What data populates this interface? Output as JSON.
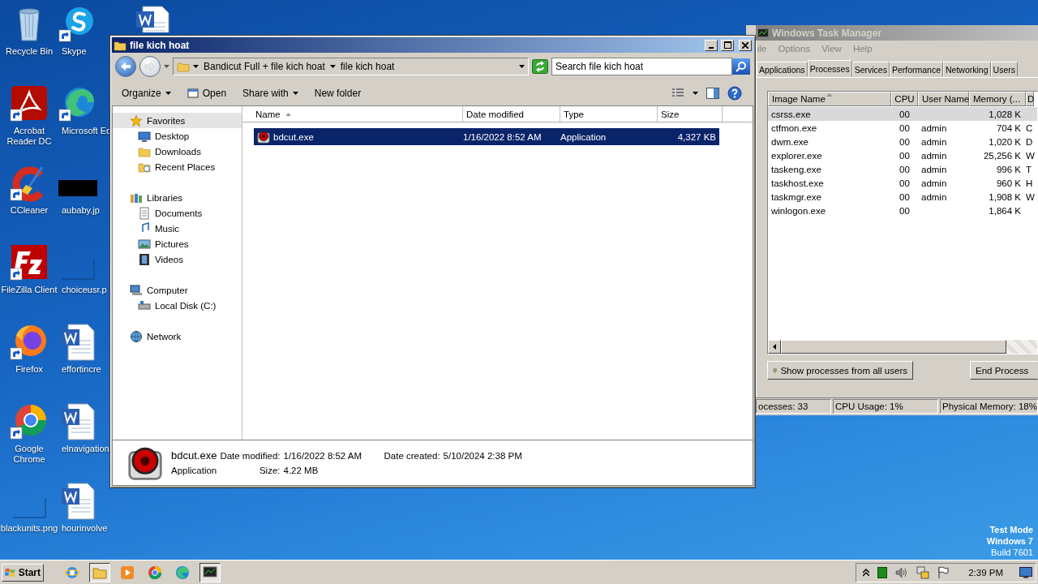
{
  "desktop": {
    "icons": [
      {
        "label": "Recycle Bin",
        "kind": "recycle",
        "shortcut": false
      },
      {
        "label": "Acrobat Reader DC",
        "kind": "acrobat",
        "shortcut": true
      },
      {
        "label": "CCleaner",
        "kind": "ccleaner",
        "shortcut": true
      },
      {
        "label": "FileZilla Client",
        "kind": "filezilla",
        "shortcut": true
      },
      {
        "label": "Firefox",
        "kind": "firefox",
        "shortcut": true
      },
      {
        "label": "Google Chrome",
        "kind": "chrome",
        "shortcut": true
      },
      {
        "label": "blackunits.png",
        "kind": "blank",
        "shortcut": false
      },
      {
        "label": "Skype",
        "kind": "skype",
        "shortcut": true
      },
      {
        "label": "Microsoft Ed",
        "kind": "edge",
        "shortcut": true
      },
      {
        "label": "aubaby.jp",
        "kind": "dark-image",
        "shortcut": false
      },
      {
        "label": "choiceusr.p",
        "kind": "blank",
        "shortcut": false
      },
      {
        "label": "effortincre",
        "kind": "word",
        "shortcut": false
      },
      {
        "label": "elnavigation",
        "kind": "word",
        "shortcut": false
      },
      {
        "label": "hourinvolve",
        "kind": "word",
        "shortcut": false
      },
      {
        "kind": "word",
        "shortcut": false
      }
    ],
    "notice": [
      "Test Mode",
      "Windows 7",
      "Build 7601"
    ]
  },
  "explorer": {
    "title": "file kich hoat",
    "active": true,
    "breadcrumb": [
      "Bandicut Full + file kich hoat",
      "file kich hoat"
    ],
    "search": {
      "placeholder": "Search file kich hoat"
    },
    "toolbar": [
      {
        "label": "Organize",
        "kind": "menu"
      },
      {
        "label": "Open",
        "kind": "open"
      },
      {
        "label": "Share with",
        "kind": "menu"
      },
      {
        "label": "New folder",
        "kind": "plain"
      }
    ],
    "nav": [
      {
        "label": "Favorites",
        "kind": "star",
        "selected": true,
        "children": [
          {
            "label": "Desktop",
            "kind": "desktop",
            "selected": false
          },
          {
            "label": "Downloads",
            "kind": "folder",
            "selected": false
          },
          {
            "label": "Recent Places",
            "kind": "recent",
            "selected": false
          }
        ]
      },
      {
        "label": "Libraries",
        "kind": "library",
        "selected": false,
        "children": [
          {
            "label": "Documents",
            "kind": "documents",
            "selected": false
          },
          {
            "label": "Music",
            "kind": "music",
            "selected": false
          },
          {
            "label": "Pictures",
            "kind": "pictures",
            "selected": false
          },
          {
            "label": "Videos",
            "kind": "videos",
            "selected": false
          }
        ]
      },
      {
        "label": "Computer",
        "kind": "computer",
        "selected": false,
        "children": [
          {
            "label": "Local Disk (C:)",
            "kind": "disk",
            "selected": false
          }
        ]
      },
      {
        "label": "Network",
        "kind": "network",
        "selected": false
      }
    ],
    "columns": [
      {
        "label": "Name",
        "sorted": true
      },
      {
        "label": "Date modified",
        "sorted": false
      },
      {
        "label": "Type",
        "sorted": false
      },
      {
        "label": "Size",
        "sorted": false
      }
    ],
    "files": [
      {
        "name": "bdcut.exe",
        "date_modified": "1/16/2022 8:52 AM",
        "type": "Application",
        "size": "4,327 KB",
        "selected": true
      }
    ],
    "details": {
      "name": "bdcut.exe",
      "type": "Application",
      "fields": [
        {
          "label": "Date modified:",
          "value": "1/16/2022 8:52 AM"
        },
        {
          "label": "Size:",
          "value": "4.22 MB"
        },
        {
          "label": "Date created:",
          "value": "5/10/2024 2:38 PM"
        }
      ]
    }
  },
  "task_manager": {
    "title": "Windows Task Manager",
    "active": false,
    "menu": [
      "ile",
      "Options",
      "View",
      "Help"
    ],
    "tabs": [
      {
        "label": "Applications",
        "selected": false
      },
      {
        "label": "Processes",
        "selected": true
      },
      {
        "label": "Services",
        "selected": false
      },
      {
        "label": "Performance",
        "selected": false
      },
      {
        "label": "Networking",
        "selected": false
      },
      {
        "label": "Users",
        "selected": false
      }
    ],
    "columns": [
      {
        "label": "Image Name",
        "sorted": true
      },
      {
        "label": "CPU",
        "sorted": false
      },
      {
        "label": "User Name",
        "sorted": false
      },
      {
        "label": "Memory (...",
        "sorted": false
      },
      {
        "label": "D",
        "sorted": false
      }
    ],
    "processes": [
      {
        "name": "csrss.exe",
        "cpu": "00",
        "memory": "1,028 K",
        "selected": true
      },
      {
        "name": "ctfmon.exe",
        "cpu": "00",
        "user": "admin",
        "memory": "704 K",
        "column_5": "C",
        "selected": false
      },
      {
        "name": "dwm.exe",
        "cpu": "00",
        "user": "admin",
        "memory": "1,020 K",
        "column_5": "D",
        "selected": false
      },
      {
        "name": "explorer.exe",
        "cpu": "00",
        "user": "admin",
        "memory": "25,256 K",
        "column_5": "W",
        "selected": false
      },
      {
        "name": "taskeng.exe",
        "cpu": "00",
        "user": "admin",
        "memory": "996 K",
        "column_5": "T",
        "selected": false
      },
      {
        "name": "taskhost.exe",
        "cpu": "00",
        "user": "admin",
        "memory": "960 K",
        "column_5": "H",
        "selected": false
      },
      {
        "name": "taskmgr.exe",
        "cpu": "00",
        "user": "admin",
        "memory": "1,908 K",
        "column_5": "W",
        "selected": false
      },
      {
        "name": "winlogon.exe",
        "cpu": "00",
        "memory": "1,864 K",
        "selected": false
      }
    ],
    "buttons": [
      {
        "label": "Show processes from all users",
        "kind": "shield"
      },
      {
        "label": "End Process",
        "kind": "plain"
      }
    ],
    "status": [
      "ocesses: 33",
      "CPU Usage: 1%",
      "Physical Memory: 18%"
    ]
  },
  "taskbar": {
    "start": "Start",
    "pinned": [
      {
        "kind": "ie",
        "active": false
      },
      {
        "kind": "folder",
        "active": true
      },
      {
        "kind": "media",
        "active": false
      },
      {
        "kind": "chrome",
        "active": false
      },
      {
        "kind": "edge",
        "active": false
      },
      {
        "kind": "taskmgr",
        "active": true
      }
    ],
    "time": "2:39 PM"
  }
}
